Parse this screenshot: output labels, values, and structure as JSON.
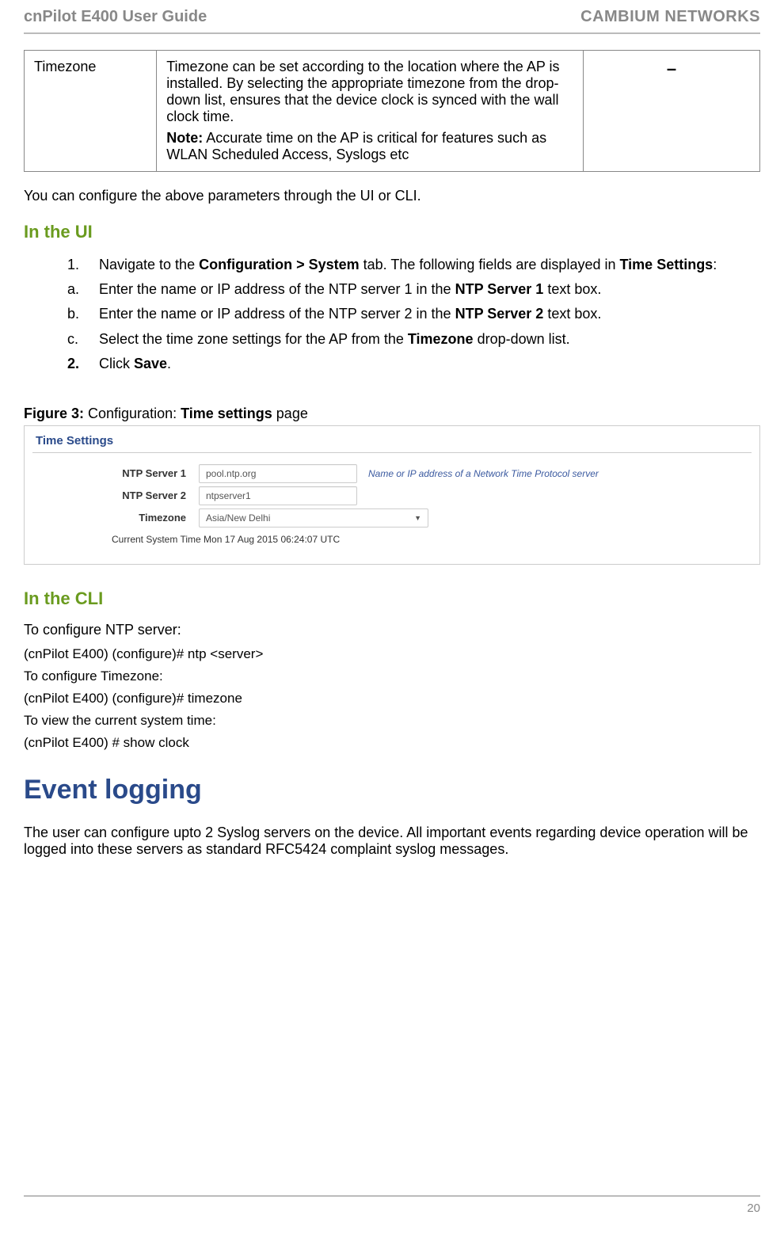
{
  "header": {
    "doc_title": "cnPilot E400 User Guide",
    "brand": "CAMBIUM NETWORKS"
  },
  "param_table": {
    "row": {
      "name": "Timezone",
      "desc_main": "Timezone can be set according to the location where the AP is installed. By selecting the appropriate timezone from the drop-down list, ensures that the device clock is synced with the wall clock time.",
      "desc_note_label": "Note:",
      "desc_note_text": " Accurate time on the AP is critical for features such as WLAN Scheduled Access, Syslogs etc",
      "default": "–"
    }
  },
  "intro_line": "You can configure the above parameters through the UI or CLI.",
  "ui_section": {
    "heading": "In the UI",
    "steps": {
      "s1_marker": "1.",
      "s1_a": "Navigate to the ",
      "s1_b": "Configuration > System",
      "s1_c": " tab. The following fields are displayed in ",
      "s1_d": "Time Settings",
      "s1_e": ":",
      "sa_marker": "a.",
      "sa_a": "Enter the name or IP address of the NTP server 1 in the ",
      "sa_b": "NTP Server 1",
      "sa_c": " text box.",
      "sb_marker": "b.",
      "sb_a": "Enter the name or IP address of the NTP server 2 in the ",
      "sb_b": "NTP Server 2",
      "sb_c": " text box.",
      "sc_marker": "c.",
      "sc_a": "Select the time zone settings for the AP from the ",
      "sc_b": "Timezone",
      "sc_c": " drop-down list.",
      "s2_marker": "2.",
      "s2_a": "Click ",
      "s2_b": "Save",
      "s2_c": "."
    }
  },
  "figure": {
    "label_a": "Figure 3:",
    "label_b": " Configuration: ",
    "label_c": "Time settings",
    "label_d": " page",
    "panel_title": "Time Settings",
    "ntp1_label": "NTP Server 1",
    "ntp1_value": "pool.ntp.org",
    "ntp1_help": "Name or IP address of a Network Time Protocol server",
    "ntp2_label": "NTP Server 2",
    "ntp2_value": "ntpserver1",
    "tz_label": "Timezone",
    "tz_value": "Asia/New Delhi",
    "systime": "Current System Time Mon 17 Aug 2015 06:24:07 UTC"
  },
  "cli_section": {
    "heading": "In the CLI",
    "sub1": "To configure NTP server:",
    "line1": "(cnPilot E400) (configure)# ntp <server>",
    "sub2": "To configure Timezone:",
    "line2": "(cnPilot E400) (configure)# timezone",
    "sub3": "To view the current system time:",
    "line3": "(cnPilot E400) # show clock"
  },
  "event_logging": {
    "heading": "Event logging",
    "body": "The user can configure upto 2 Syslog servers on the device. All important events regarding device operation will be logged into these servers as standard RFC5424 complaint syslog messages."
  },
  "page_number": "20"
}
